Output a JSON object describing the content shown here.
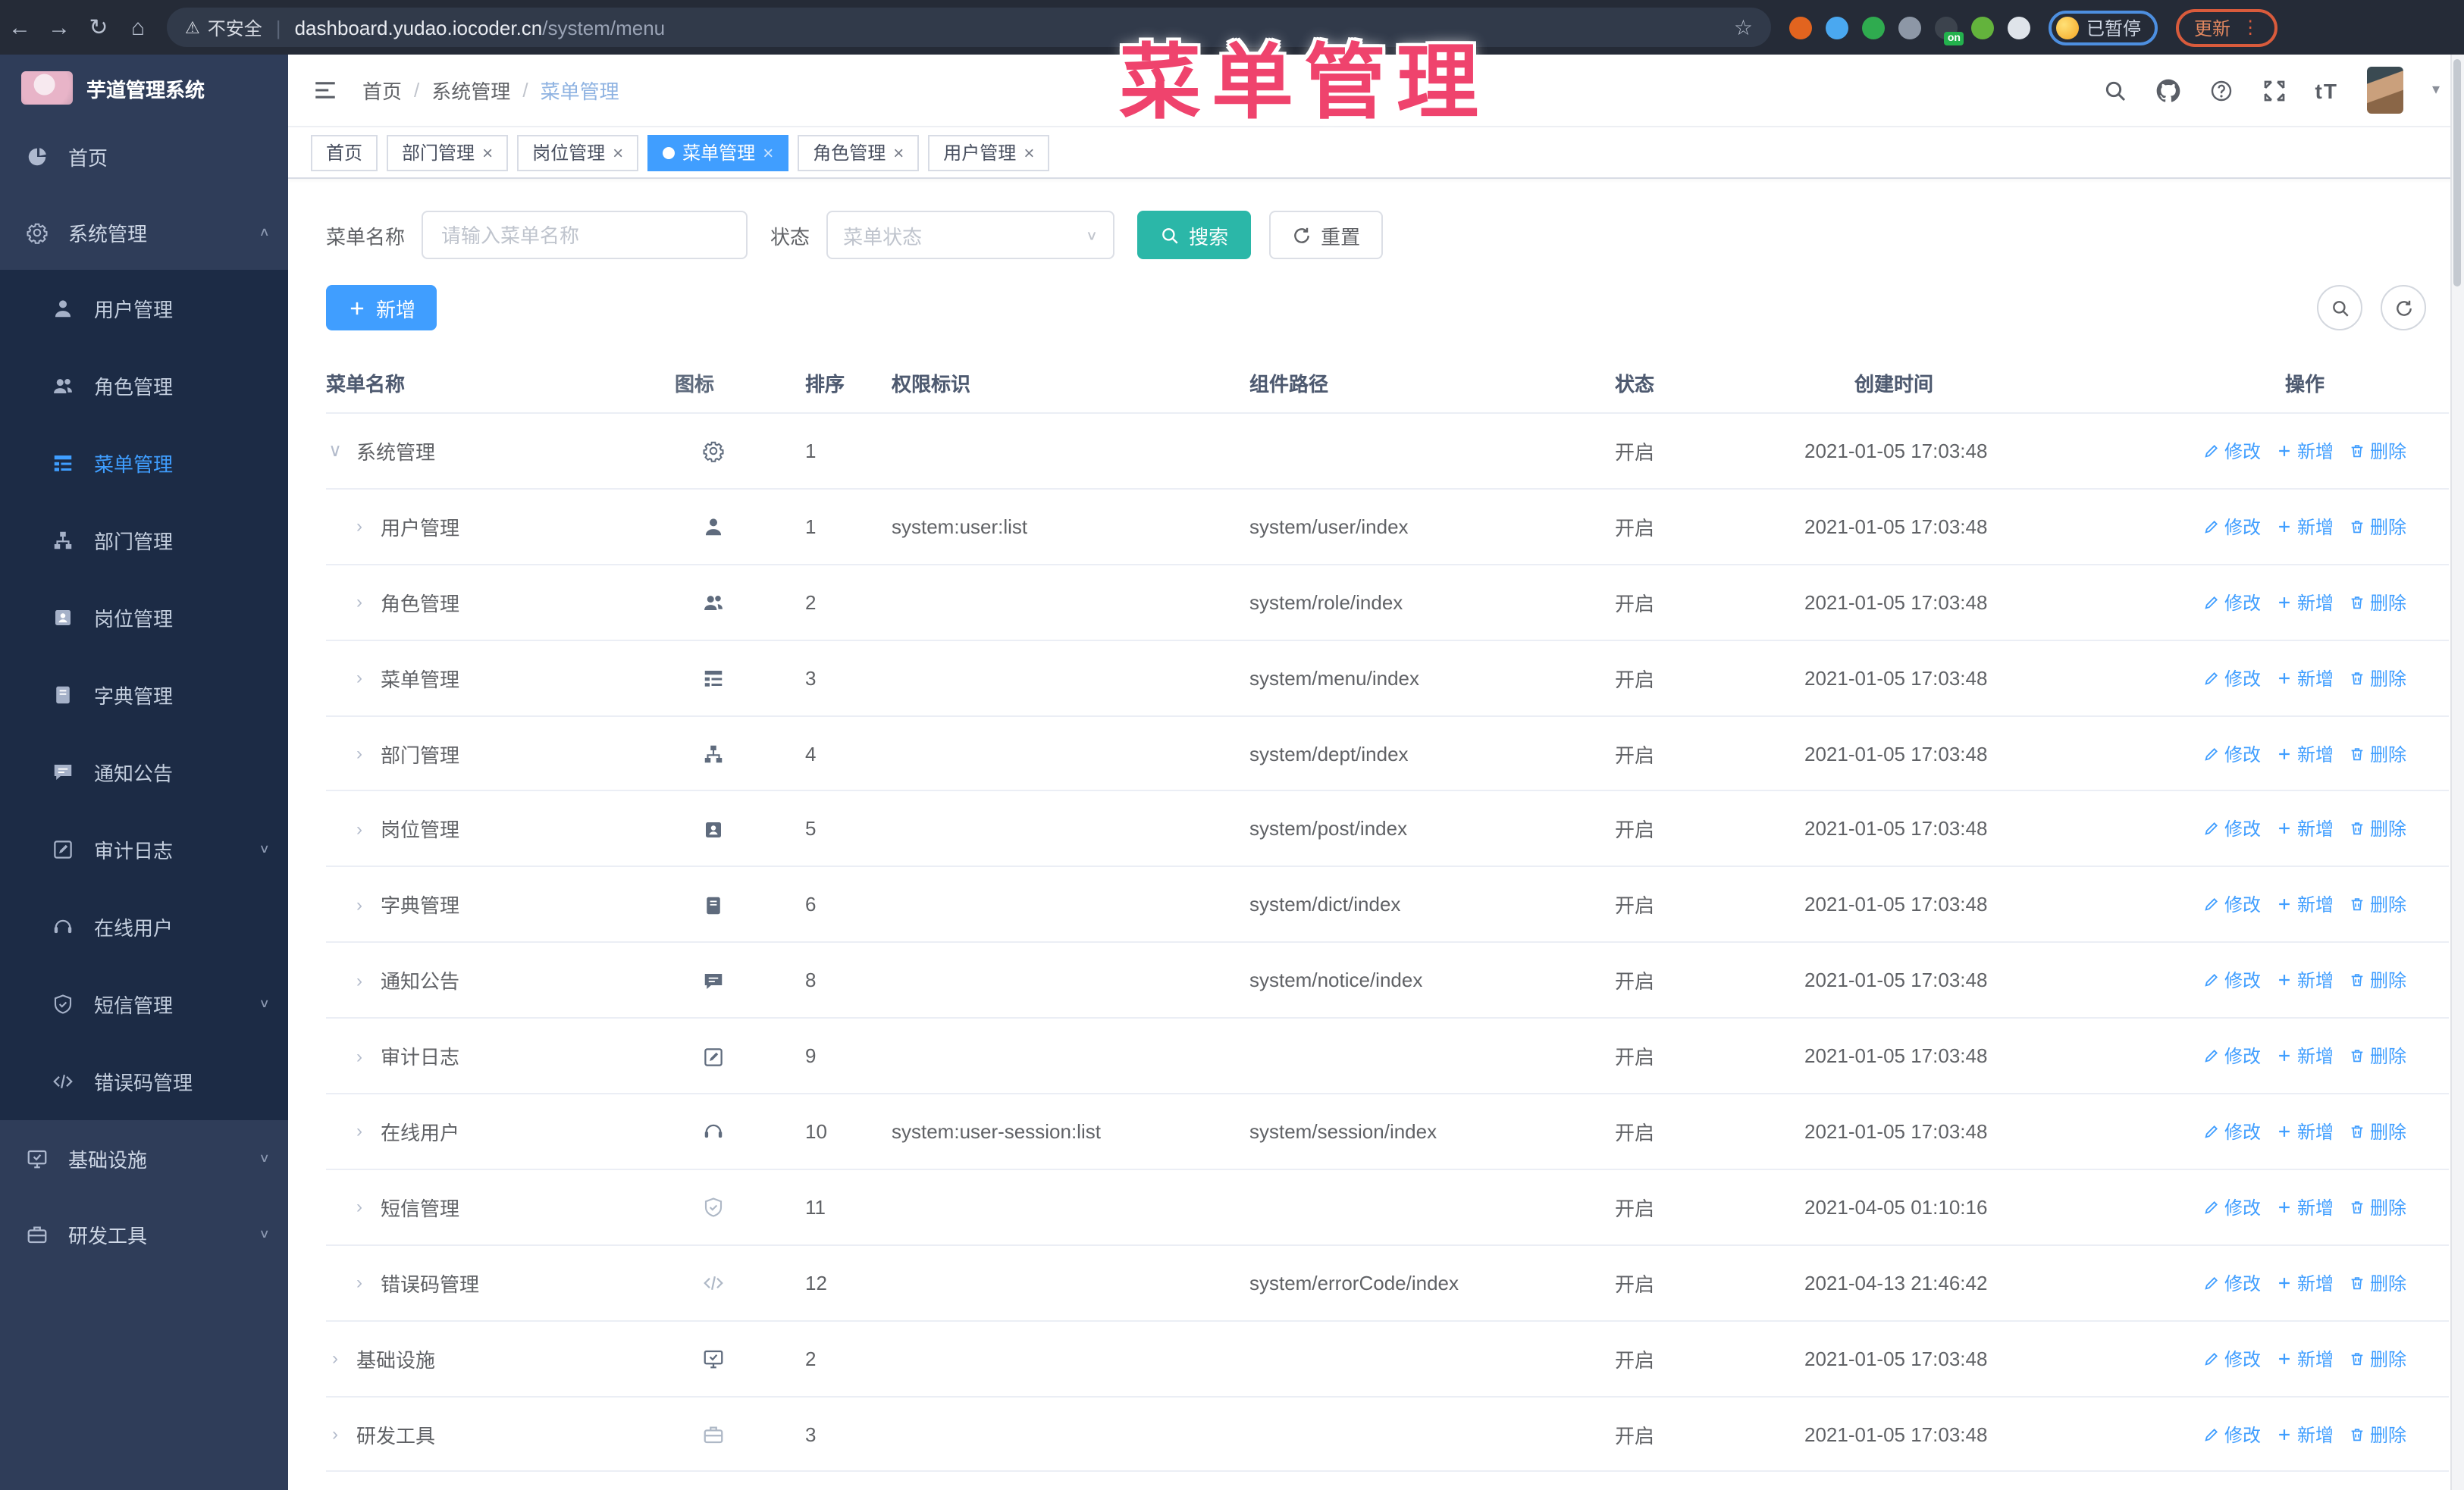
{
  "browser": {
    "security_label": "不安全",
    "url_host": "dashboard.yudao.iocoder.cn",
    "url_path": "/system/menu",
    "paused_badge": "已暂停",
    "update_button": "更新",
    "extensions": [
      {
        "name": "orange-extension",
        "color": "#e2641f"
      },
      {
        "name": "gem-extension",
        "color": "#4aa8f0"
      },
      {
        "name": "green-check-extension",
        "color": "#2fab4f"
      },
      {
        "name": "gray-extension",
        "color": "#8d97a6"
      },
      {
        "name": "proxy-extension",
        "color": "#3c434d",
        "label": "on"
      },
      {
        "name": "green-extension",
        "color": "#63b33c"
      },
      {
        "name": "puzzle-extension",
        "color": "#dfe4ea"
      }
    ]
  },
  "overlay_title": "菜单管理",
  "sidebar": {
    "title": "芋道管理系统",
    "items": [
      {
        "label": "首页",
        "icon": "pie"
      },
      {
        "label": "系统管理",
        "icon": "gear",
        "caret": "up",
        "open": true,
        "children": [
          {
            "label": "用户管理",
            "icon": "person"
          },
          {
            "label": "角色管理",
            "icon": "people"
          },
          {
            "label": "菜单管理",
            "icon": "menu",
            "active": true
          },
          {
            "label": "部门管理",
            "icon": "org"
          },
          {
            "label": "岗位管理",
            "icon": "badge"
          },
          {
            "label": "字典管理",
            "icon": "book"
          },
          {
            "label": "通知公告",
            "icon": "chat"
          },
          {
            "label": "审计日志",
            "icon": "edit",
            "caret": "down"
          },
          {
            "label": "在线用户",
            "icon": "headset"
          },
          {
            "label": "短信管理",
            "icon": "shield",
            "caret": "down"
          },
          {
            "label": "错误码管理",
            "icon": "code"
          }
        ]
      },
      {
        "label": "基础设施",
        "icon": "monitor",
        "caret": "down"
      },
      {
        "label": "研发工具",
        "icon": "briefcase",
        "caret": "down"
      }
    ]
  },
  "header": {
    "breadcrumb": [
      "首页",
      "系统管理",
      "菜单管理"
    ],
    "separator": "/"
  },
  "tabs": [
    {
      "label": "首页",
      "closable": false,
      "active": false
    },
    {
      "label": "部门管理",
      "closable": true,
      "active": false
    },
    {
      "label": "岗位管理",
      "closable": true,
      "active": false
    },
    {
      "label": "菜单管理",
      "closable": true,
      "active": true
    },
    {
      "label": "角色管理",
      "closable": true,
      "active": false
    },
    {
      "label": "用户管理",
      "closable": true,
      "active": false
    }
  ],
  "filters": {
    "name_label": "菜单名称",
    "name_placeholder": "请输入菜单名称",
    "status_label": "状态",
    "status_placeholder": "菜单状态",
    "search_button": "搜索",
    "reset_button": "重置"
  },
  "toolbar": {
    "add_button": "新增"
  },
  "table": {
    "columns": [
      "菜单名称",
      "图标",
      "排序",
      "权限标识",
      "组件路径",
      "状态",
      "创建时间",
      "操作"
    ],
    "row_actions": {
      "edit": "修改",
      "add": "新增",
      "delete": "删除"
    },
    "rows": [
      {
        "name": "系统管理",
        "level": 0,
        "expanded": true,
        "icon": "gear",
        "muted": false,
        "sort": "1",
        "perm": "",
        "path": "",
        "status": "开启",
        "time": "2021-01-05 17:03:48"
      },
      {
        "name": "用户管理",
        "level": 1,
        "expanded": false,
        "icon": "person",
        "muted": false,
        "sort": "1",
        "perm": "system:user:list",
        "path": "system/user/index",
        "status": "开启",
        "time": "2021-01-05 17:03:48"
      },
      {
        "name": "角色管理",
        "level": 1,
        "expanded": false,
        "icon": "people",
        "muted": false,
        "sort": "2",
        "perm": "",
        "path": "system/role/index",
        "status": "开启",
        "time": "2021-01-05 17:03:48"
      },
      {
        "name": "菜单管理",
        "level": 1,
        "expanded": false,
        "icon": "menu",
        "muted": false,
        "sort": "3",
        "perm": "",
        "path": "system/menu/index",
        "status": "开启",
        "time": "2021-01-05 17:03:48"
      },
      {
        "name": "部门管理",
        "level": 1,
        "expanded": false,
        "icon": "org",
        "muted": false,
        "sort": "4",
        "perm": "",
        "path": "system/dept/index",
        "status": "开启",
        "time": "2021-01-05 17:03:48"
      },
      {
        "name": "岗位管理",
        "level": 1,
        "expanded": false,
        "icon": "badge",
        "muted": false,
        "sort": "5",
        "perm": "",
        "path": "system/post/index",
        "status": "开启",
        "time": "2021-01-05 17:03:48"
      },
      {
        "name": "字典管理",
        "level": 1,
        "expanded": false,
        "icon": "book",
        "muted": false,
        "sort": "6",
        "perm": "",
        "path": "system/dict/index",
        "status": "开启",
        "time": "2021-01-05 17:03:48"
      },
      {
        "name": "通知公告",
        "level": 1,
        "expanded": false,
        "icon": "chat",
        "muted": false,
        "sort": "8",
        "perm": "",
        "path": "system/notice/index",
        "status": "开启",
        "time": "2021-01-05 17:03:48"
      },
      {
        "name": "审计日志",
        "level": 1,
        "expanded": false,
        "icon": "edit",
        "muted": false,
        "sort": "9",
        "perm": "",
        "path": "",
        "status": "开启",
        "time": "2021-01-05 17:03:48"
      },
      {
        "name": "在线用户",
        "level": 1,
        "expanded": false,
        "icon": "headset",
        "muted": false,
        "sort": "10",
        "perm": "system:user-session:list",
        "path": "system/session/index",
        "status": "开启",
        "time": "2021-01-05 17:03:48"
      },
      {
        "name": "短信管理",
        "level": 1,
        "expanded": false,
        "icon": "shield",
        "muted": true,
        "sort": "11",
        "perm": "",
        "path": "",
        "status": "开启",
        "time": "2021-04-05 01:10:16"
      },
      {
        "name": "错误码管理",
        "level": 1,
        "expanded": false,
        "icon": "code",
        "muted": true,
        "sort": "12",
        "perm": "",
        "path": "system/errorCode/index",
        "status": "开启",
        "time": "2021-04-13 21:46:42"
      },
      {
        "name": "基础设施",
        "level": 0,
        "expanded": false,
        "icon": "monitor",
        "muted": false,
        "sort": "2",
        "perm": "",
        "path": "",
        "status": "开启",
        "time": "2021-01-05 17:03:48"
      },
      {
        "name": "研发工具",
        "level": 0,
        "expanded": false,
        "icon": "briefcase",
        "muted": true,
        "sort": "3",
        "perm": "",
        "path": "",
        "status": "开启",
        "time": "2021-01-05 17:03:48"
      }
    ]
  },
  "colors": {
    "accent_blue": "#409eff",
    "search_teal": "#2bb7a8",
    "overlay_pink": "#ef436d",
    "sidebar_bg": "#2f3d59",
    "submenu_bg": "#1c2b45",
    "chrome_bg": "#252b37"
  }
}
